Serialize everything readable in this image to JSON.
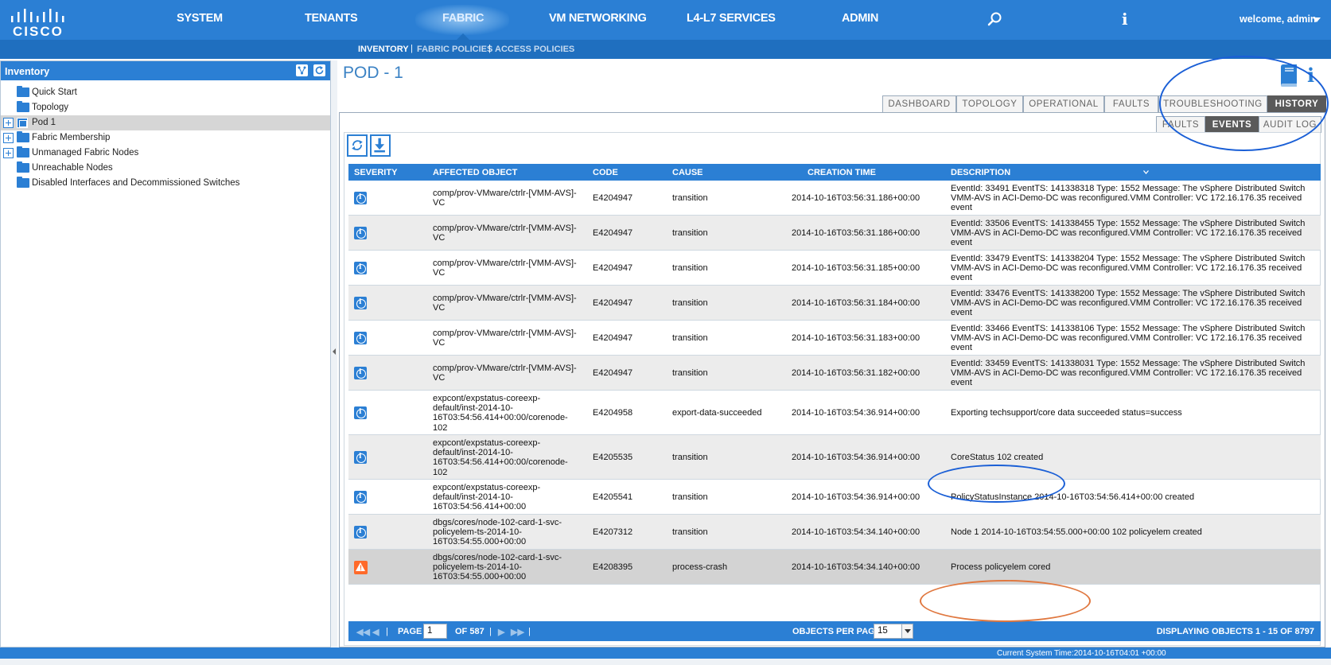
{
  "topnav": {
    "logo_text": "CISCO",
    "items": [
      "SYSTEM",
      "TENANTS",
      "FABRIC",
      "VM NETWORKING",
      "L4-L7 SERVICES",
      "ADMIN"
    ],
    "info_glyph": "i",
    "user_label": "welcome, admin"
  },
  "subnav": {
    "items": [
      "INVENTORY",
      "FABRIC POLICIES",
      "ACCESS POLICIES"
    ],
    "separator": "|"
  },
  "sidebar": {
    "title": "Inventory",
    "items": [
      {
        "label": "Quick Start",
        "expandable": false,
        "selected": false,
        "icon": "folder-icon"
      },
      {
        "label": "Topology",
        "expandable": false,
        "selected": false,
        "icon": "folder-icon"
      },
      {
        "label": "Pod 1",
        "expandable": true,
        "selected": true,
        "icon": "pod-icon"
      },
      {
        "label": "Fabric Membership",
        "expandable": true,
        "selected": false,
        "icon": "folder-icon"
      },
      {
        "label": "Unmanaged Fabric Nodes",
        "expandable": true,
        "selected": false,
        "icon": "folder-icon"
      },
      {
        "label": "Unreachable Nodes",
        "expandable": false,
        "selected": false,
        "icon": "folder-icon"
      },
      {
        "label": "Disabled Interfaces and Decommissioned Switches",
        "expandable": false,
        "selected": false,
        "icon": "folder-icon"
      }
    ]
  },
  "main": {
    "title": "POD - 1",
    "info_glyph": "i",
    "tabs": [
      "DASHBOARD",
      "TOPOLOGY",
      "OPERATIONAL",
      "FAULTS",
      "TROUBLESHOOTING",
      "HISTORY"
    ],
    "active_tab": "HISTORY",
    "subtabs": [
      "FAULTS",
      "EVENTS",
      "AUDIT LOG"
    ],
    "active_subtab": "EVENTS"
  },
  "table": {
    "columns": [
      "SEVERITY",
      "AFFECTED OBJECT",
      "CODE",
      "CAUSE",
      "CREATION TIME",
      "DESCRIPTION"
    ],
    "rows": [
      {
        "severity": "info",
        "object": "comp/prov-VMware/ctrlr-[VMM-AVS]-\nVC",
        "code": "E4204947",
        "cause": "transition",
        "time": "2014-10-16T03:56:31.186+00:00",
        "description": "EventId: 33491 EventTS: 141338318 Type: 1552 Message: The vSphere Distributed Switch\nVMM-AVS in ACI-Demo-DC was reconfigured.VMM Controller: VC 172.16.176.35 received\nevent"
      },
      {
        "severity": "info",
        "object": "comp/prov-VMware/ctrlr-[VMM-AVS]-\nVC",
        "code": "E4204947",
        "cause": "transition",
        "time": "2014-10-16T03:56:31.186+00:00",
        "description": "EventId: 33506 EventTS: 141338455 Type: 1552 Message: The vSphere Distributed Switch\nVMM-AVS in ACI-Demo-DC was reconfigured.VMM Controller: VC 172.16.176.35 received\nevent"
      },
      {
        "severity": "info",
        "object": "comp/prov-VMware/ctrlr-[VMM-AVS]-\nVC",
        "code": "E4204947",
        "cause": "transition",
        "time": "2014-10-16T03:56:31.185+00:00",
        "description": "EventId: 33479 EventTS: 141338204 Type: 1552 Message: The vSphere Distributed Switch\nVMM-AVS in ACI-Demo-DC was reconfigured.VMM Controller: VC 172.16.176.35 received\nevent"
      },
      {
        "severity": "info",
        "object": "comp/prov-VMware/ctrlr-[VMM-AVS]-\nVC",
        "code": "E4204947",
        "cause": "transition",
        "time": "2014-10-16T03:56:31.184+00:00",
        "description": "EventId: 33476 EventTS: 141338200 Type: 1552 Message: The vSphere Distributed Switch\nVMM-AVS in ACI-Demo-DC was reconfigured.VMM Controller: VC 172.16.176.35 received\nevent"
      },
      {
        "severity": "info",
        "object": "comp/prov-VMware/ctrlr-[VMM-AVS]-\nVC",
        "code": "E4204947",
        "cause": "transition",
        "time": "2014-10-16T03:56:31.183+00:00",
        "description": "EventId: 33466 EventTS: 141338106 Type: 1552 Message: The vSphere Distributed Switch\nVMM-AVS in ACI-Demo-DC was reconfigured.VMM Controller: VC 172.16.176.35 received\nevent"
      },
      {
        "severity": "info",
        "object": "comp/prov-VMware/ctrlr-[VMM-AVS]-\nVC",
        "code": "E4204947",
        "cause": "transition",
        "time": "2014-10-16T03:56:31.182+00:00",
        "description": "EventId: 33459 EventTS: 141338031 Type: 1552 Message: The vSphere Distributed Switch\nVMM-AVS in ACI-Demo-DC was reconfigured.VMM Controller: VC 172.16.176.35 received\nevent"
      },
      {
        "severity": "info",
        "object": "expcont/expstatus-coreexp-\ndefault/inst-2014-10-\n16T03:54:56.414+00:00/corenode-\n102",
        "code": "E4204958",
        "cause": "export-data-succeeded",
        "time": "2014-10-16T03:54:36.914+00:00",
        "description": "Exporting techsupport/core data succeeded status=success"
      },
      {
        "severity": "info",
        "object": "expcont/expstatus-coreexp-\ndefault/inst-2014-10-\n16T03:54:56.414+00:00/corenode-\n102",
        "code": "E4205535",
        "cause": "transition",
        "time": "2014-10-16T03:54:36.914+00:00",
        "description": "CoreStatus 102 created"
      },
      {
        "severity": "info",
        "object": "expcont/expstatus-coreexp-\ndefault/inst-2014-10-\n16T03:54:56.414+00:00",
        "code": "E4205541",
        "cause": "transition",
        "time": "2014-10-16T03:54:36.914+00:00",
        "description": "PolicyStatusInstance 2014-10-16T03:54:56.414+00:00 created"
      },
      {
        "severity": "info",
        "object": "dbgs/cores/node-102-card-1-svc-\npolicyelem-ts-2014-10-\n16T03:54:55.000+00:00",
        "code": "E4207312",
        "cause": "transition",
        "time": "2014-10-16T03:54:34.140+00:00",
        "description": "Node 1 2014-10-16T03:54:55.000+00:00 102 policyelem created"
      },
      {
        "severity": "warning",
        "object": "dbgs/cores/node-102-card-1-svc-\npolicyelem-ts-2014-10-\n16T03:54:55.000+00:00",
        "code": "E4208395",
        "cause": "process-crash",
        "time": "2014-10-16T03:54:34.140+00:00",
        "description": "Process policyelem cored"
      }
    ]
  },
  "pagination": {
    "page_label": "PAGE",
    "page_value": "1",
    "of_label": "OF 587",
    "per_page_label": "OBJECTS PER PAGE:",
    "per_page_value": "15",
    "display_text": "DISPLAYING OBJECTS 1 - 15 OF 8797"
  },
  "status": {
    "text": "Current System Time:2014-10-16T04:01 +00:00"
  },
  "colors": {
    "brand_blue": "#2b7fd4",
    "dark_blue": "#1f6fbf",
    "annotation_blue": "#1a5fd6",
    "annotation_orange": "#e07840",
    "warning": "#ff6a2a"
  }
}
